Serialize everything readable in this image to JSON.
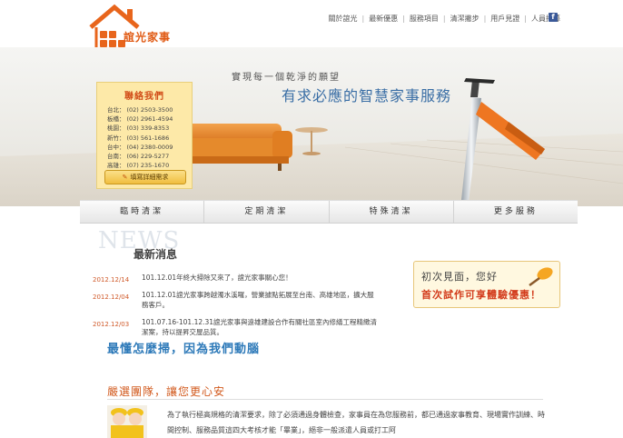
{
  "brand": {
    "name": "誼光家事",
    "logo_icon": "house-logo-icon"
  },
  "topnav": {
    "items": [
      "關於誼光",
      "最新優惠",
      "服務項目",
      "清潔撇步",
      "用戶見證",
      "人員招募"
    ],
    "facebook_label": "f"
  },
  "hero": {
    "slogan_small": "實現每一個乾淨的願望",
    "slogan_large": "有求必應的智慧家事服務"
  },
  "contact": {
    "title": "聯絡我們",
    "rows": [
      {
        "city": "台北：",
        "phone": "(02) 2503-3500"
      },
      {
        "city": "板橋：",
        "phone": "(02) 2961-4594"
      },
      {
        "city": "桃園：",
        "phone": "(03) 339-8353"
      },
      {
        "city": "新竹：",
        "phone": "(03) 561-1686"
      },
      {
        "city": "台中：",
        "phone": "(04) 2380-0009"
      },
      {
        "city": "台南：",
        "phone": "(06) 229-5277"
      },
      {
        "city": "高雄：",
        "phone": "(07) 235-1670"
      }
    ],
    "button": "填寫詳細需求"
  },
  "menu": [
    "臨時清潔",
    "定期清潔",
    "特殊清潔",
    "更多服務"
  ],
  "news": {
    "watermark": "NEWS",
    "title": "最新消息",
    "items": [
      {
        "date": "2012.12/14",
        "text": "101.12.01年終大掃除又來了，誼光家事關心您！"
      },
      {
        "date": "2012.12/04",
        "text": "101.12.01誼光家事跨越濁水溪囉，營業據點拓展至台南、高雄地區，擴大服務客戶。"
      },
      {
        "date": "2012.12/03",
        "text": "101.07.16-101.12.31誼光家事與遠雄建設合作有關社區室內修繕工程精緻清潔案，持以提昇交屋品質。"
      }
    ]
  },
  "motto": "最懂怎麼掃，因為我們動腦",
  "promo": {
    "line1": "初次見面，您好",
    "line2": "首次試作可享體驗優惠！"
  },
  "team": {
    "title": "嚴選團隊，讓您更心安",
    "text": "為了執行極高規格的清潔要求，除了必須通過身體檢查，家事員在為您服務前，都已通過家事教育、現場實作訓練、時間控制、服務品質這四大考核才能「畢業」，絕非一般派遣人員或打工阿"
  },
  "colors": {
    "accent": "#e05a14",
    "link_blue": "#2e7ab9",
    "date": "#d05a2a",
    "card_bg": "#fde9a8"
  }
}
